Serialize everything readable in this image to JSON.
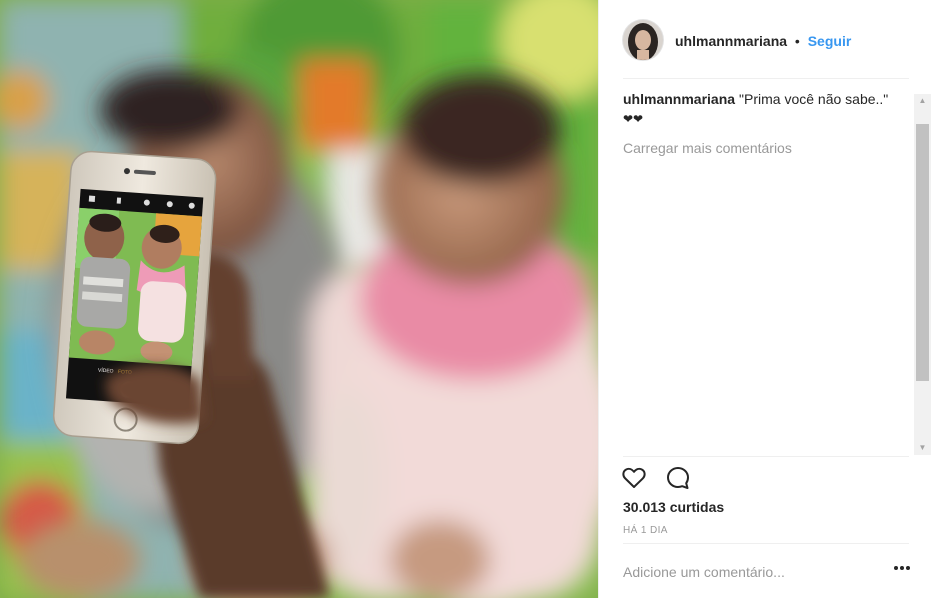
{
  "post": {
    "username": "uhlmannmariana",
    "separator": "•",
    "follow_label": "Seguir"
  },
  "caption": {
    "username": "uhlmannmariana",
    "text": "\"Prima você não sabe..\"",
    "emoji": "❤❤"
  },
  "comments": {
    "load_more_label": "Carregar mais comentários"
  },
  "stats": {
    "likes_label": "30.013 curtidas",
    "time_label": "HÁ 1 DIA"
  },
  "add_comment": {
    "placeholder": "Adicione um comentário..."
  },
  "icons": {
    "like": "heart-outline-icon",
    "comment": "speech-bubble-icon",
    "options": "ellipsis-icon"
  },
  "colors": {
    "accent": "#3897f0",
    "muted": "#999999",
    "text": "#262626"
  },
  "phone_screen": {
    "mode_labels": [
      "VÍDEO",
      "FOTO"
    ]
  }
}
